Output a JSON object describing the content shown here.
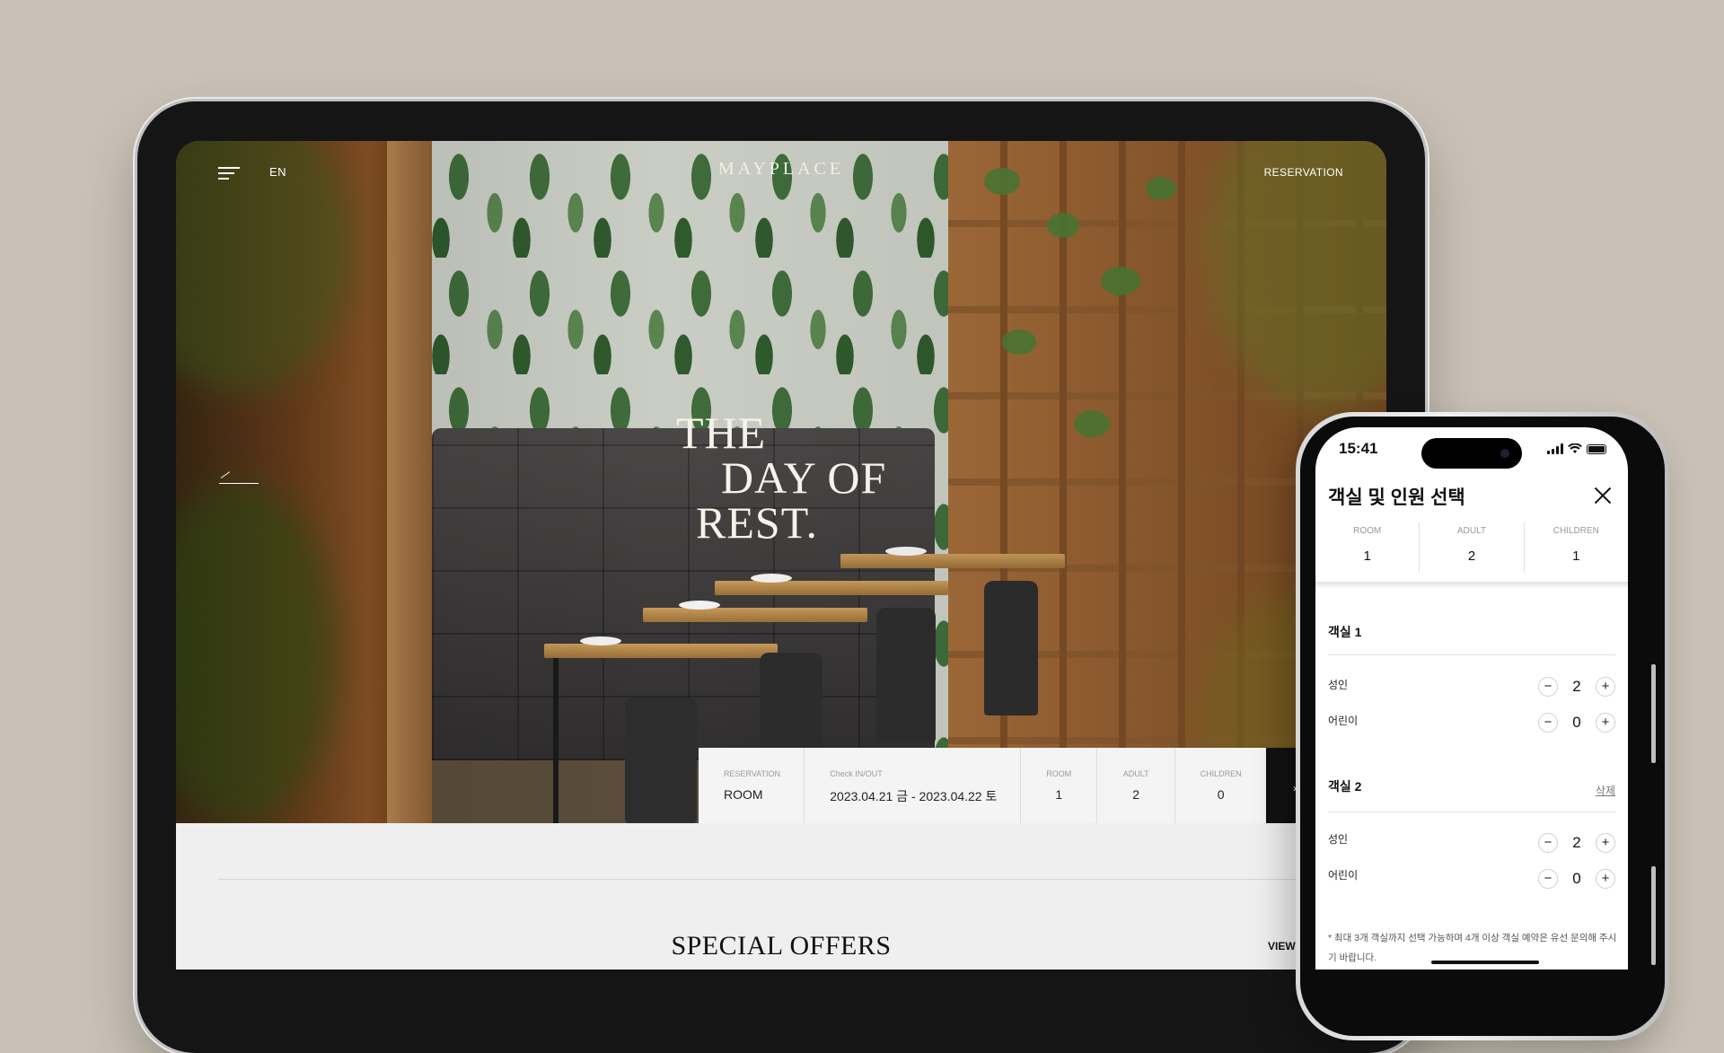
{
  "tablet": {
    "header": {
      "lang": "EN",
      "logo": "MAYPLACE",
      "reservation": "RESERVATION"
    },
    "hero": {
      "headline": [
        "THE",
        "DAY OF",
        "REST."
      ]
    },
    "booking": {
      "reservation": {
        "label": "RESERVATION",
        "value": "ROOM"
      },
      "check": {
        "label": "Check IN/OUT",
        "value": "2023.04.21 금 - 2023.04.22 토"
      },
      "room": {
        "label": "ROOM",
        "value": "1"
      },
      "adult": {
        "label": "ADULT",
        "value": "2"
      },
      "children": {
        "label": "CHILDREN",
        "value": "0"
      }
    },
    "section": {
      "title": "SPECIAL OFFERS",
      "view_all": "VIEW"
    }
  },
  "phone": {
    "status": {
      "time": "15:41"
    },
    "sheet": {
      "title": "객실 및 인원 선택",
      "summary": [
        {
          "label": "ROOM",
          "value": "1"
        },
        {
          "label": "ADULT",
          "value": "2"
        },
        {
          "label": "CHILDREN",
          "value": "1"
        }
      ],
      "rooms": [
        {
          "title": "객실 1",
          "adult_label": "성인",
          "adult": "2",
          "child_label": "어린이",
          "child": "0"
        },
        {
          "title": "객실 2",
          "delete": "삭제",
          "adult_label": "성인",
          "adult": "2",
          "child_label": "어린이",
          "child": "0"
        }
      ],
      "notice": "* 최대 3개 객실까지 선택 가능하며 4개 이상 객실 예약은 유선 문의해 주시기 바랍니다.",
      "minus": "−",
      "plus": "+"
    }
  },
  "colors": {
    "background": "#c9c1b5",
    "bezel": "#151515",
    "booking_button": "#111111"
  },
  "icons": [
    "hamburger-menu-icon",
    "arrow-left-icon",
    "close-icon",
    "signal-icon",
    "wifi-icon",
    "battery-icon"
  ]
}
